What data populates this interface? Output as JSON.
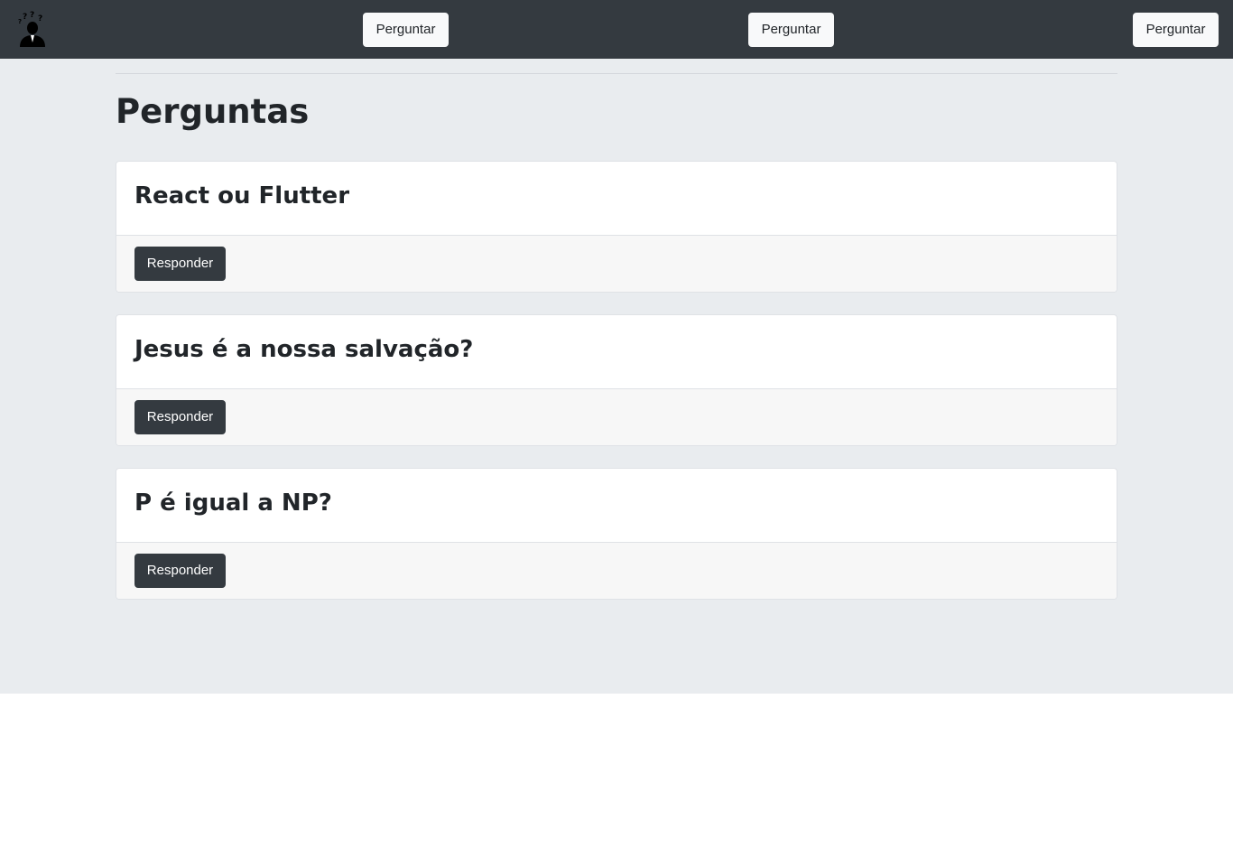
{
  "navbar": {
    "logo_icon": "thinking-person-icon",
    "buttons": [
      "Perguntar",
      "Perguntar",
      "Perguntar"
    ]
  },
  "main": {
    "title": "Perguntas",
    "questions": [
      {
        "title": "React ou Flutter",
        "action_label": "Responder"
      },
      {
        "title": "Jesus é a nossa salvação?",
        "action_label": "Responder"
      },
      {
        "title": "P é igual a NP?",
        "action_label": "Responder"
      }
    ]
  },
  "colors": {
    "navbar_bg": "#343a40",
    "jumbotron_bg": "#e9ecef",
    "card_footer_bg": "#f7f7f7",
    "dark_button": "#343a40",
    "light_button": "#f8f9fa"
  }
}
